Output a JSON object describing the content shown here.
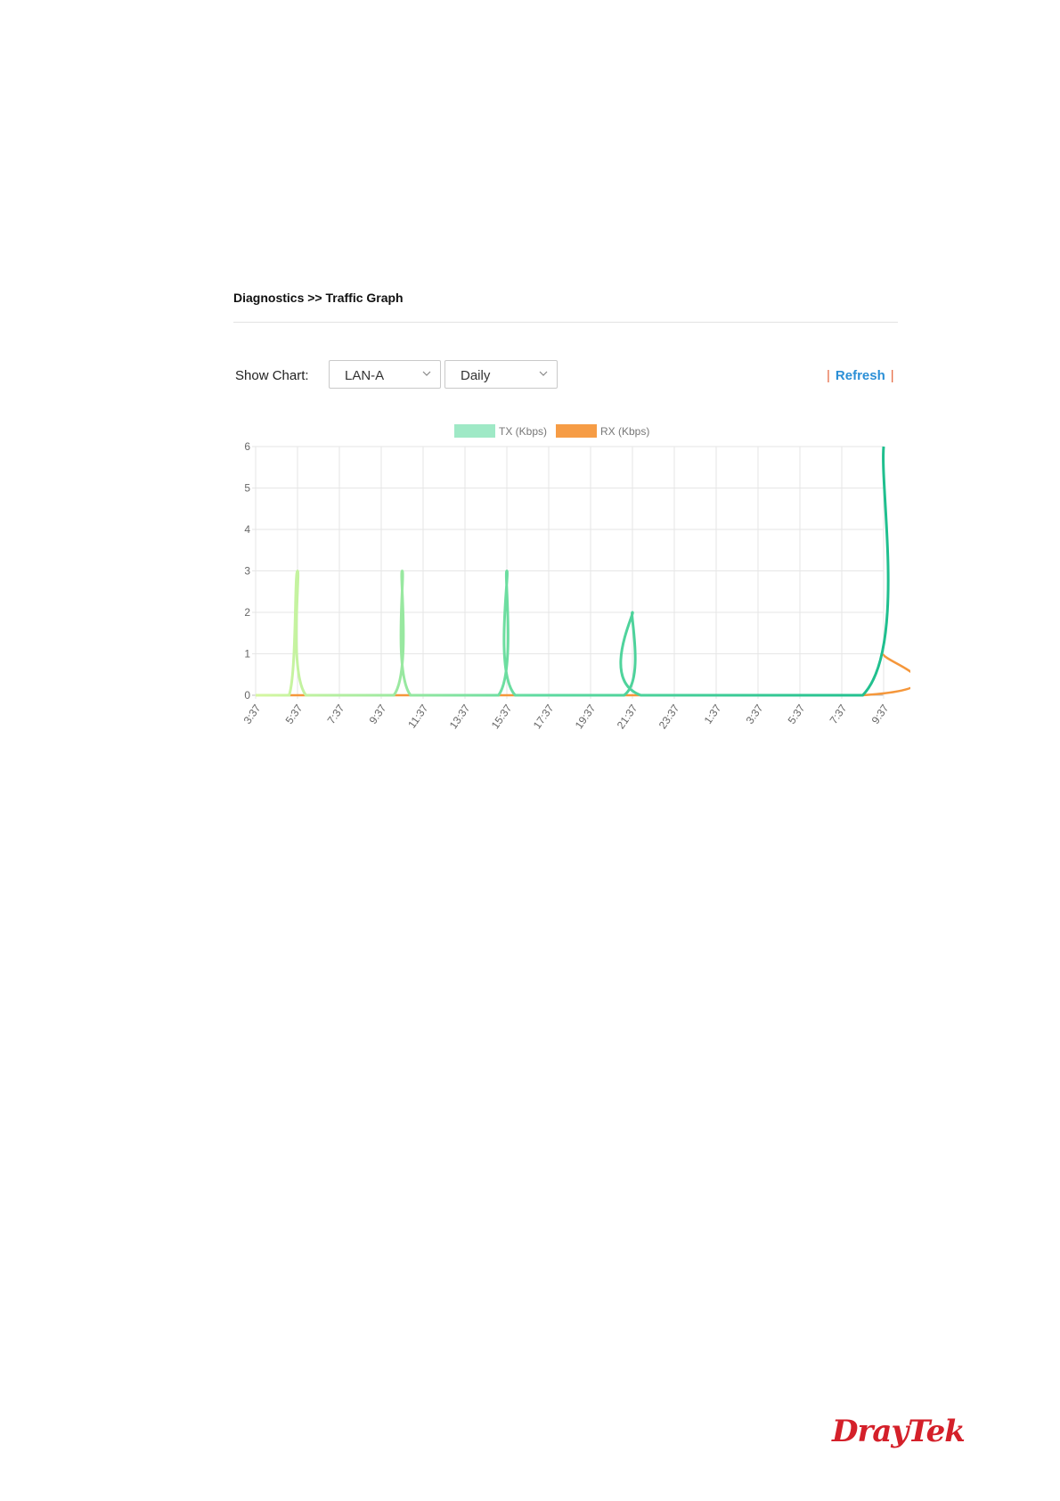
{
  "breadcrumb": "Diagnostics >> Traffic Graph",
  "toolbar": {
    "show_chart_label": "Show Chart:",
    "interface_value": "LAN-A",
    "period_value": "Daily",
    "refresh_label": "Refresh"
  },
  "colors": {
    "tx": "#5fdaa0",
    "rx": "#f5973b",
    "tx_peak_light": "#d6f7a0",
    "tx_peak_dark": "#1fbf8e",
    "accent_link": "#2b8fd6",
    "logo": "#d4202a"
  },
  "chart_data": {
    "type": "line",
    "legend_position": "top",
    "grid": true,
    "x_ticks": [
      "3:37",
      "5:37",
      "7:37",
      "9:37",
      "11:37",
      "13:37",
      "15:37",
      "17:37",
      "19:37",
      "21:37",
      "23:37",
      "1:37",
      "3:37",
      "5:37",
      "7:37",
      "9:37"
    ],
    "ylim": [
      0,
      6
    ],
    "y_ticks": [
      0,
      1,
      2,
      3,
      4,
      5,
      6
    ],
    "series": [
      {
        "name": "TX (Kbps)",
        "points": [
          [
            0,
            0
          ],
          [
            0.8,
            0
          ],
          [
            1.0,
            3
          ],
          [
            1.2,
            0
          ],
          [
            3.3,
            0
          ],
          [
            3.5,
            3
          ],
          [
            3.7,
            0
          ],
          [
            5.8,
            0
          ],
          [
            6.0,
            3
          ],
          [
            6.2,
            0
          ],
          [
            8.8,
            0
          ],
          [
            9.0,
            2
          ],
          [
            9.2,
            0
          ],
          [
            14.5,
            0
          ],
          [
            15.0,
            6
          ]
        ]
      },
      {
        "name": "RX (Kbps)",
        "points": [
          [
            0,
            0
          ],
          [
            14.5,
            0
          ],
          [
            15.0,
            1
          ]
        ]
      }
    ]
  },
  "logo_text": "DrayTek"
}
